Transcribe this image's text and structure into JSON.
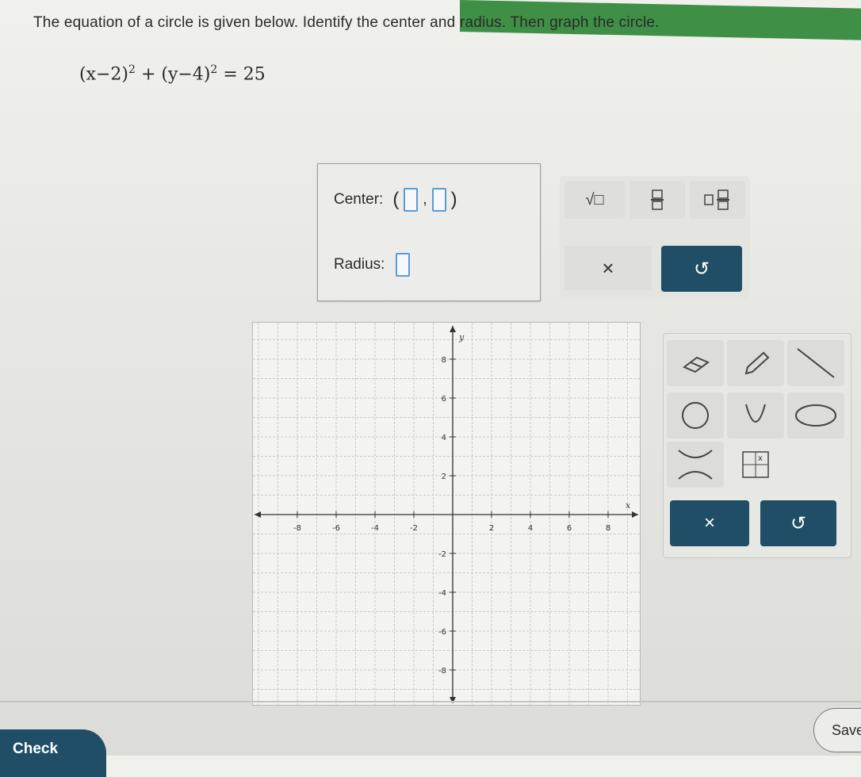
{
  "prompt": "The equation of a circle is given below. Identify the center and radius. Then graph the circle.",
  "equation": {
    "part1": "(x−2)",
    "exp1": "2",
    "plus": "+",
    "part2": "(y−4)",
    "exp2": "2",
    "rhs": "= 25"
  },
  "answer": {
    "center_label": "Center:",
    "radius_label": "Radius:",
    "comma": ","
  },
  "keypad": {
    "sqrt": "√□",
    "times": "×",
    "undo": "↺"
  },
  "graph": {
    "x_label": "x",
    "y_label": "y",
    "xlim": [
      -10,
      10
    ],
    "ylim": [
      -10,
      10
    ],
    "x_ticks": [
      "-8",
      "-6",
      "-4",
      "-2",
      "2",
      "4",
      "6",
      "8"
    ],
    "y_ticks": [
      "8",
      "6",
      "4",
      "2",
      "-2",
      "-4",
      "-6",
      "-8"
    ]
  },
  "graph_tools": {
    "times": "×",
    "undo": "↺"
  },
  "footer": {
    "save_label": "Save",
    "check_label": "Check"
  }
}
